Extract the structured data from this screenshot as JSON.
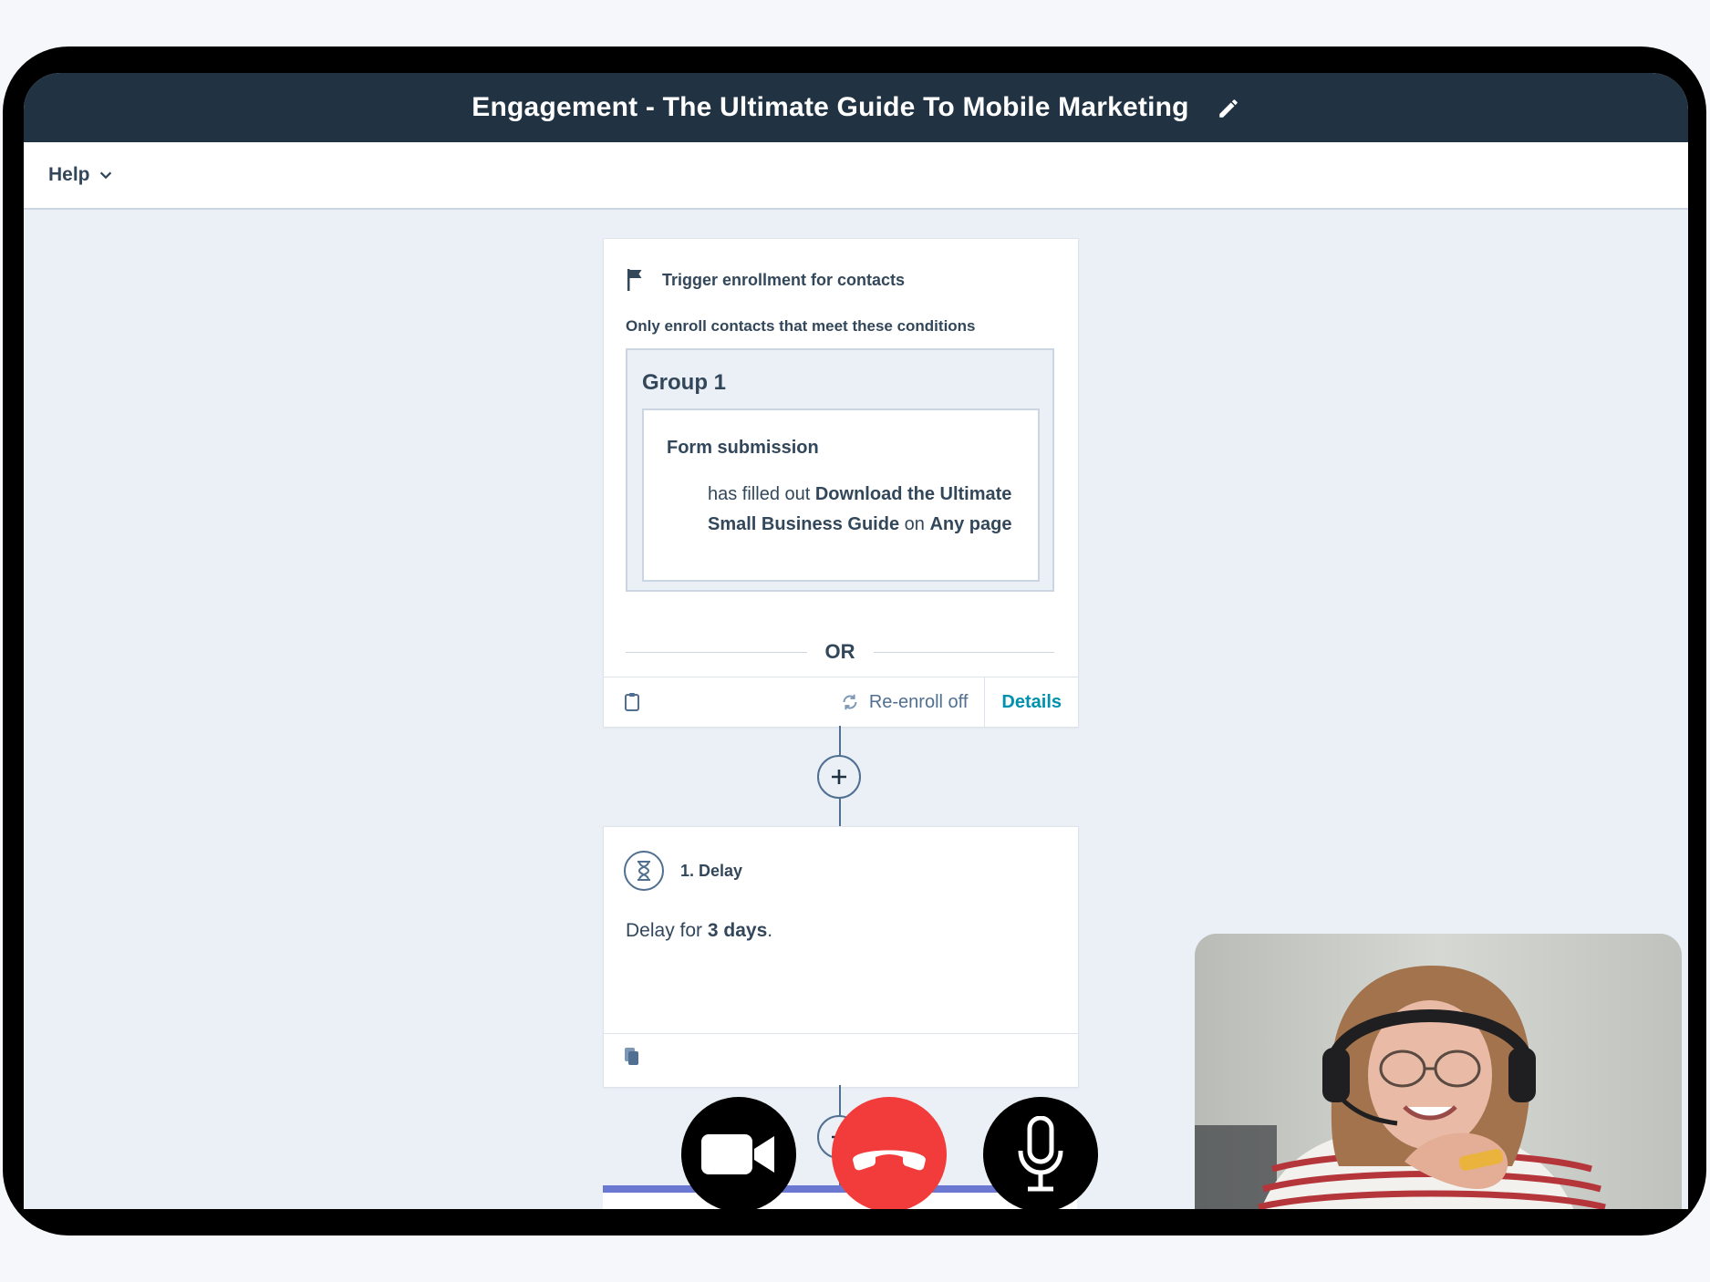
{
  "window": {
    "title": "Engagement - The Ultimate Guide To Mobile Marketing"
  },
  "toolbar": {
    "help_label": "Help"
  },
  "trigger": {
    "title": "Trigger enrollment for contacts",
    "subtitle": "Only enroll contacts that meet these conditions",
    "group_title": "Group 1",
    "condition_title": "Form submission",
    "condition_prefix": "has filled out",
    "form_name": "Download the Ultimate Small Business Guide",
    "page_prefix": "on",
    "page_value": "Any page",
    "or_label": "OR",
    "reenroll_label": "Re-enroll off",
    "details_label": "Details"
  },
  "delay": {
    "title": "1. Delay",
    "text_prefix": "Delay for",
    "duration": "3 days",
    "text_suffix": "."
  },
  "call_controls": {
    "camera_icon": "video-camera-icon",
    "end_icon": "phone-hangup-icon",
    "mic_icon": "microphone-icon",
    "end_color": "#f23b3b"
  },
  "colors": {
    "header_bg": "#213343",
    "canvas_bg": "#eaf0f6",
    "link": "#0091ae",
    "next_action_accent": "#6a78d1"
  }
}
